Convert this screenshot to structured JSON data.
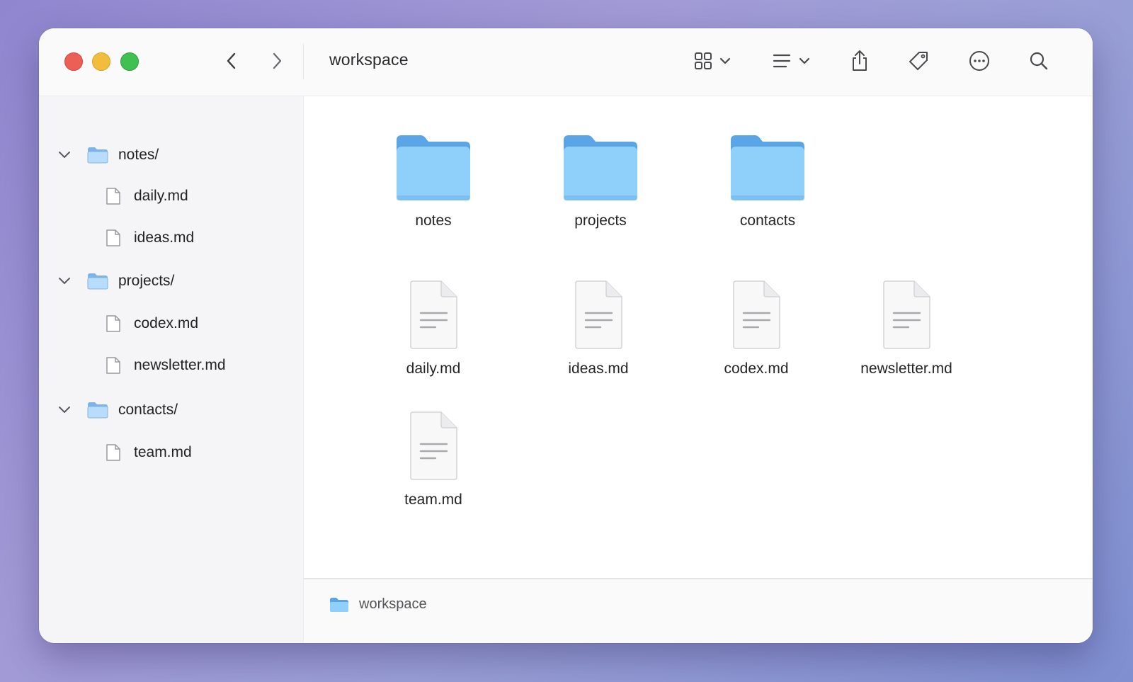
{
  "window": {
    "title": "workspace"
  },
  "toolbar": {
    "items": [
      {
        "name": "view-grid-icon",
        "has_menu": true
      },
      {
        "name": "group-list-icon",
        "has_menu": true
      },
      {
        "name": "share-icon"
      },
      {
        "name": "tag-icon"
      },
      {
        "name": "more-icon"
      },
      {
        "name": "search-icon"
      }
    ]
  },
  "sidebar": {
    "folders": [
      {
        "label": "notes/",
        "expanded": true,
        "files": [
          "daily.md",
          "ideas.md"
        ]
      },
      {
        "label": "projects/",
        "expanded": true,
        "files": [
          "codex.md",
          "newsletter.md"
        ]
      },
      {
        "label": "contacts/",
        "expanded": true,
        "files": [
          "team.md"
        ]
      }
    ]
  },
  "content": {
    "folders": [
      "notes",
      "projects",
      "contacts"
    ],
    "files": [
      "daily.md",
      "ideas.md",
      "codex.md",
      "newsletter.md",
      "team.md"
    ]
  },
  "statusbar": {
    "path": "workspace"
  },
  "colors": {
    "folder_body": "#8fd0fb",
    "folder_tab": "#5aa5e8",
    "close": "#ec5f57",
    "minimize": "#f2bd3a",
    "maximize": "#3fc14f"
  }
}
